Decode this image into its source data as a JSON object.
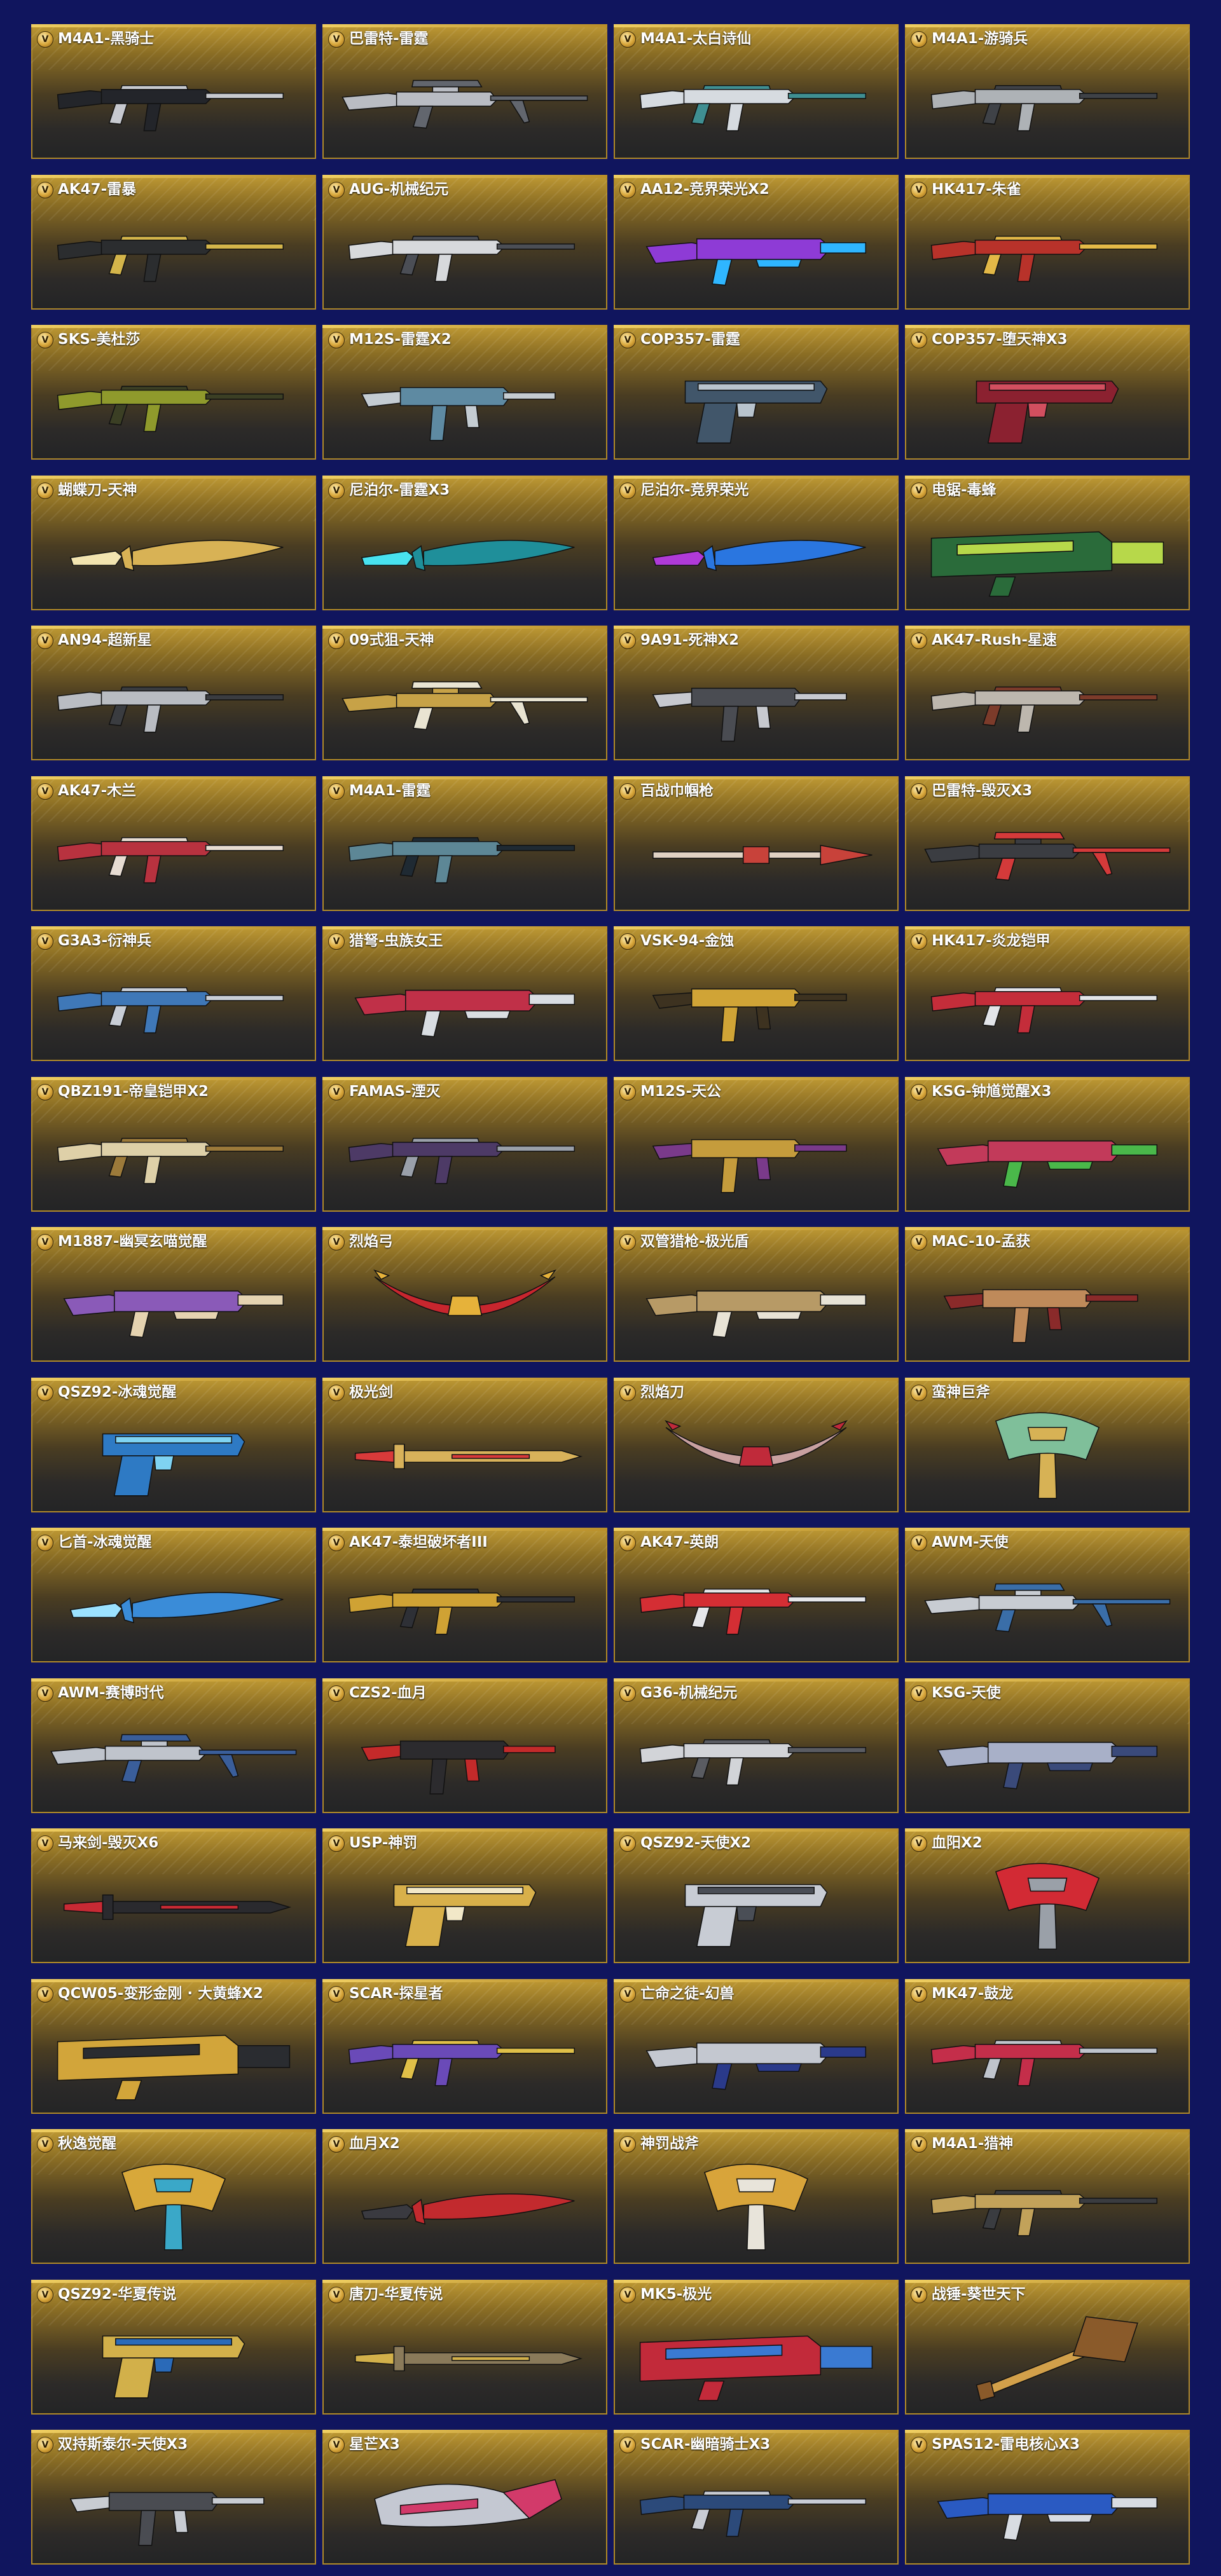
{
  "badge_letter": "V",
  "colors": {
    "background": "#10155e",
    "card_top": "#c09a34",
    "card_bottom": "#232426",
    "border": "#b08a28"
  },
  "weapons": [
    {
      "name": "M4A1-黑骑士",
      "kind": "rifle",
      "color": "#23252a",
      "accent": "#c7c9cf"
    },
    {
      "name": "巴雷特-雷霆",
      "kind": "sniper",
      "color": "#b9bcc3",
      "accent": "#62666e"
    },
    {
      "name": "M4A1-太白诗仙",
      "kind": "rifle",
      "color": "#d6dbe0",
      "accent": "#3f8f92"
    },
    {
      "name": "M4A1-游骑兵",
      "kind": "rifle",
      "color": "#aeb2b6",
      "accent": "#3f4247"
    },
    {
      "name": "AK47-雷暴",
      "kind": "rifle",
      "color": "#2b2d2f",
      "accent": "#d4b54a"
    },
    {
      "name": "AUG-机械纪元",
      "kind": "rifle",
      "color": "#d7d9dc",
      "accent": "#4b4e55"
    },
    {
      "name": "AA12-竞界荣光X2",
      "kind": "shotgun",
      "color": "#8e3bd6",
      "accent": "#2fb6ff"
    },
    {
      "name": "HK417-朱雀",
      "kind": "rifle",
      "color": "#b8322a",
      "accent": "#e3b847"
    },
    {
      "name": "SKS-美杜莎",
      "kind": "rifle",
      "color": "#8f9a2c",
      "accent": "#3b3f24"
    },
    {
      "name": "M12S-雷霆X2",
      "kind": "smg",
      "color": "#5e8aa2",
      "accent": "#c4ccd2"
    },
    {
      "name": "COP357-雷霆",
      "kind": "pistol",
      "color": "#41566a",
      "accent": "#b9c4cd"
    },
    {
      "name": "COP357-堕天神X3",
      "kind": "pistol",
      "color": "#8b2130",
      "accent": "#d24f5f"
    },
    {
      "name": "蝴蝶刀-天神",
      "kind": "knife",
      "color": "#d8b255",
      "accent": "#f2e4b0"
    },
    {
      "name": "尼泊尔-雷霆X3",
      "kind": "knife",
      "color": "#1f8f9a",
      "accent": "#48e2ef"
    },
    {
      "name": "尼泊尔-竞界荣光",
      "kind": "knife",
      "color": "#2a76e0",
      "accent": "#b03ad8"
    },
    {
      "name": "电锯-毒蜂",
      "kind": "heavy",
      "color": "#2a6b3a",
      "accent": "#b7d84a"
    },
    {
      "name": "AN94-超新星",
      "kind": "rifle",
      "color": "#b9bcc2",
      "accent": "#3a3c40"
    },
    {
      "name": "09式狙-天神",
      "kind": "sniper",
      "color": "#c7a247",
      "accent": "#e9e4d2"
    },
    {
      "name": "9A91-死神X2",
      "kind": "smg",
      "color": "#4a4c52",
      "accent": "#c7c9cf"
    },
    {
      "name": "AK47-Rush-星速",
      "kind": "rifle",
      "color": "#bdb7ae",
      "accent": "#7c3b2a"
    },
    {
      "name": "AK47-木兰",
      "kind": "rifle",
      "color": "#b8323f",
      "accent": "#e7dcd2"
    },
    {
      "name": "M4A1-雷霆",
      "kind": "rifle",
      "color": "#5d8796",
      "accent": "#1f2a33"
    },
    {
      "name": "百战巾帼枪",
      "kind": "spear",
      "color": "#c8423a",
      "accent": "#e0d2c4"
    },
    {
      "name": "巴雷特-毁灭X3",
      "kind": "sniper",
      "color": "#3b3d42",
      "accent": "#d43a3a"
    },
    {
      "name": "G3A3-衍神兵",
      "kind": "rifle",
      "color": "#3f78b8",
      "accent": "#c9ced6"
    },
    {
      "name": "猎弩-虫族女王",
      "kind": "shotgun",
      "color": "#c03048",
      "accent": "#d9dde2"
    },
    {
      "name": "VSK-94-金蚀",
      "kind": "smg",
      "color": "#d0a436",
      "accent": "#3d3220"
    },
    {
      "name": "HK417-炎龙铠甲",
      "kind": "rifle",
      "color": "#c42d3a",
      "accent": "#e2e4e8"
    },
    {
      "name": "QBZ191-帝皇铠甲X2",
      "kind": "rifle",
      "color": "#ded0a8",
      "accent": "#9c7a3a"
    },
    {
      "name": "FAMAS-湮灭",
      "kind": "rifle",
      "color": "#4d3a66",
      "accent": "#9aa0aa"
    },
    {
      "name": "M12S-天公",
      "kind": "smg",
      "color": "#c59c3c",
      "accent": "#7a3a8a"
    },
    {
      "name": "KSG-钟馗觉醒X3",
      "kind": "shotgun",
      "color": "#c23a5a",
      "accent": "#4ab84a"
    },
    {
      "name": "M1887-幽冥玄喵觉醒",
      "kind": "shotgun",
      "color": "#8a5ab8",
      "accent": "#e5d3b0"
    },
    {
      "name": "烈焰弓",
      "kind": "bow",
      "color": "#c8262e",
      "accent": "#e6b23a"
    },
    {
      "name": "双管猎枪-极光盾",
      "kind": "shotgun",
      "color": "#b79a66",
      "accent": "#e8e3d6"
    },
    {
      "name": "MAC-10-孟获",
      "kind": "smg",
      "color": "#bf8a5a",
      "accent": "#8a2a2a"
    },
    {
      "name": "QSZ92-冰魂觉醒",
      "kind": "pistol",
      "color": "#2e7ac4",
      "accent": "#7fd3f2"
    },
    {
      "name": "极光剑",
      "kind": "sword",
      "color": "#d8b25a",
      "accent": "#d93a3a"
    },
    {
      "name": "烈焰刀",
      "kind": "bow",
      "color": "#c8a0a0",
      "accent": "#c02a3a"
    },
    {
      "name": "蛮神巨斧",
      "kind": "axe",
      "color": "#7fbf9a",
      "accent": "#d7b255"
    },
    {
      "name": "匕首-冰魂觉醒",
      "kind": "knife",
      "color": "#3a8cd8",
      "accent": "#9be2ff"
    },
    {
      "name": "AK47-泰坦破坏者III",
      "kind": "rifle",
      "color": "#cfa234",
      "accent": "#2e3036"
    },
    {
      "name": "AK47-英朗",
      "kind": "rifle",
      "color": "#d42e34",
      "accent": "#e6e7ea"
    },
    {
      "name": "AWM-天使",
      "kind": "sniper",
      "color": "#c8ccd2",
      "accent": "#3a6ea8"
    },
    {
      "name": "AWM-赛博时代",
      "kind": "sniper",
      "color": "#bfc4cc",
      "accent": "#3a5e9a"
    },
    {
      "name": "CZS2-血月",
      "kind": "smg",
      "color": "#2c2b2e",
      "accent": "#c42a2a"
    },
    {
      "name": "G36-机械纪元",
      "kind": "rifle",
      "color": "#d2d4d8",
      "accent": "#5a5c62"
    },
    {
      "name": "KSG-天使",
      "kind": "shotgun",
      "color": "#a8b0c8",
      "accent": "#3a4a7a"
    },
    {
      "name": "马来剑-毁灭X6",
      "kind": "sword",
      "color": "#2a2a2e",
      "accent": "#c82a34"
    },
    {
      "name": "USP-神罚",
      "kind": "pistol",
      "color": "#d8b04a",
      "accent": "#f2e8c8"
    },
    {
      "name": "QSZ92-天使X2",
      "kind": "pistol",
      "color": "#c8ccd4",
      "accent": "#4a4e56"
    },
    {
      "name": "血阳X2",
      "kind": "axe",
      "color": "#d22a34",
      "accent": "#9aa0a8"
    },
    {
      "name": "QCW05-变形金刚 · 大黄蜂X2",
      "kind": "heavy",
      "color": "#d2a53a",
      "accent": "#2a2c30"
    },
    {
      "name": "SCAR-探星者",
      "kind": "rifle",
      "color": "#6a4ab8",
      "accent": "#e0c048"
    },
    {
      "name": "亡命之徒-幻兽",
      "kind": "shotgun",
      "color": "#c4c8d0",
      "accent": "#2a3a8a"
    },
    {
      "name": "MK47-鼓龙",
      "kind": "rifle",
      "color": "#c42e4a",
      "accent": "#bfc4cc"
    },
    {
      "name": "秋逸觉醒",
      "kind": "axe",
      "color": "#d8a83a",
      "accent": "#3aa8c8"
    },
    {
      "name": "血月X2",
      "kind": "knife",
      "color": "#c22a2e",
      "accent": "#3a3a40"
    },
    {
      "name": "神罚战斧",
      "kind": "axe",
      "color": "#d8a43a",
      "accent": "#e8e4da"
    },
    {
      "name": "M4A1-猎神",
      "kind": "rifle",
      "color": "#c2a25a",
      "accent": "#3a3c40"
    },
    {
      "name": "QSZ92-华夏传说",
      "kind": "pistol",
      "color": "#d2b04a",
      "accent": "#2a6ab8"
    },
    {
      "name": "唐刀-华夏传说",
      "kind": "sword",
      "color": "#8a7a5a",
      "accent": "#d2b04a"
    },
    {
      "name": "MK5-极光",
      "kind": "heavy",
      "color": "#c22a3a",
      "accent": "#3a7ad2"
    },
    {
      "name": "战锤-葵世天下",
      "kind": "hammer",
      "color": "#8a5a2a",
      "accent": "#d2a04a"
    },
    {
      "name": "双持斯泰尔-天使X3",
      "kind": "smg",
      "color": "#4a4c52",
      "accent": "#c8ccd2"
    },
    {
      "name": "星芒X3",
      "kind": "gauntlet",
      "color": "#c4c8d2",
      "accent": "#d23a6a"
    },
    {
      "name": "SCAR-幽暗骑士X3",
      "kind": "rifle",
      "color": "#2c4a7a",
      "accent": "#c8ccd4"
    },
    {
      "name": "SPAS12-雷电核心X3",
      "kind": "shotgun",
      "color": "#2a5ac2",
      "accent": "#d8dce2"
    }
  ]
}
